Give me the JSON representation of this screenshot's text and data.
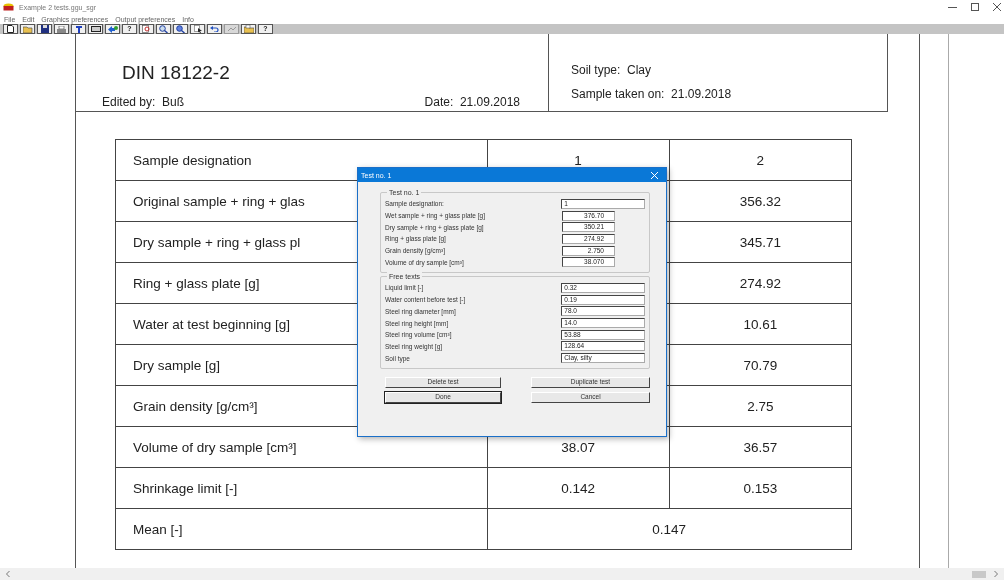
{
  "window": {
    "title": "Example 2 tests.ggu_sgr"
  },
  "menu": [
    "File",
    "Edit",
    "Graphics preferences",
    "Output preferences",
    "Info"
  ],
  "toolbar": [
    {
      "kind": "new",
      "disabled": false
    },
    {
      "kind": "open",
      "disabled": false
    },
    {
      "kind": "save",
      "disabled": false
    },
    {
      "kind": "print",
      "disabled": false
    },
    {
      "kind": "filter",
      "disabled": false
    },
    {
      "kind": "frame",
      "disabled": false
    },
    {
      "kind": "move",
      "disabled": false
    },
    {
      "kind": "help",
      "label": "?",
      "disabled": false
    },
    {
      "kind": "zoom-page",
      "disabled": false
    },
    {
      "kind": "zoom-in",
      "disabled": false
    },
    {
      "kind": "zoom-out",
      "disabled": false
    },
    {
      "kind": "select",
      "disabled": false
    },
    {
      "kind": "undo",
      "disabled": false
    },
    {
      "kind": "redo",
      "disabled": true
    },
    {
      "kind": "folder",
      "disabled": false
    },
    {
      "kind": "help",
      "label": "?",
      "disabled": false
    }
  ],
  "header": {
    "title_lines": [
      "DIN 18122-2"
    ],
    "edited_by": {
      "label": "Edited by:",
      "value": "Buß"
    },
    "date": {
      "label": "Date:",
      "value": "21.09.2018"
    },
    "info": [
      {
        "label": "Soil type:",
        "value": "Clay"
      },
      {
        "label": "Sample taken on:",
        "value": "21.09.2018"
      }
    ]
  },
  "table": {
    "rows": [
      {
        "kind": "split",
        "label": "Sample designation",
        "value_1": "1",
        "value_2": "2"
      },
      {
        "kind": "split",
        "label": "Original sample + ring + glas",
        "value_2": "356.32"
      },
      {
        "kind": "split",
        "label": "Dry sample + ring + glass pl",
        "value_2": "345.71"
      },
      {
        "kind": "split",
        "label": "Ring + glass plate [g]",
        "value_2": "274.92"
      },
      {
        "kind": "split",
        "label": "Water at test beginning [g]",
        "value_2": "10.61"
      },
      {
        "kind": "split",
        "label": "Dry sample [g]",
        "value_2": "70.79"
      },
      {
        "kind": "split",
        "label": "Grain density [g/cm³]",
        "value_2": "2.75"
      },
      {
        "kind": "split",
        "label": "Volume of dry sample [cm³]",
        "value_1": "38.07",
        "value_2": "36.57"
      },
      {
        "kind": "split",
        "label": "Shrinkage limit [-]",
        "value_1": "0.142",
        "value_2": "0.153"
      },
      {
        "kind": "merged",
        "label": "Mean [-]",
        "value": "0.147"
      }
    ]
  },
  "dialog": {
    "title": "Test no. 1",
    "groups": [
      {
        "title": "Test no. 1",
        "fields": [
          {
            "kind": "text",
            "label": "Sample designation:",
            "value": "1"
          },
          {
            "kind": "number",
            "label": "Wet sample + ring + glass plate [g]",
            "value": "376.70"
          },
          {
            "kind": "number",
            "label": "Dry sample + ring + glass plate [g]",
            "value": "350.21"
          },
          {
            "kind": "number",
            "label": "Ring + glass plate [g]",
            "value": "274.92"
          },
          {
            "kind": "number",
            "label": "Grain density [g/cm³]",
            "value": "2.750"
          },
          {
            "kind": "number",
            "label": "Volume of dry sample [cm³]",
            "value": "38.070"
          }
        ]
      },
      {
        "title": "Free texts",
        "fields": [
          {
            "kind": "text",
            "label": "Liquid limit [-]",
            "value": "0.32"
          },
          {
            "kind": "text",
            "label": "Water content before test [-]",
            "value": "0.19"
          },
          {
            "kind": "text",
            "label": "Steel ring diameter [mm]",
            "value": "78.0"
          },
          {
            "kind": "text",
            "label": "Steel ring height [mm]",
            "value": "14.0"
          },
          {
            "kind": "text",
            "label": "Steel ring volume [cm³]",
            "value": "53.88"
          },
          {
            "kind": "text",
            "label": "Steel ring weight [g]",
            "value": "128.64"
          },
          {
            "kind": "text",
            "label": "Soil type",
            "value": "Clay, silty"
          }
        ]
      }
    ],
    "buttons": [
      {
        "label": "Delete test",
        "default": false
      },
      {
        "label": "Duplicate test",
        "default": false
      },
      {
        "label": "Done",
        "default": true
      },
      {
        "label": "Cancel",
        "default": false
      }
    ]
  }
}
